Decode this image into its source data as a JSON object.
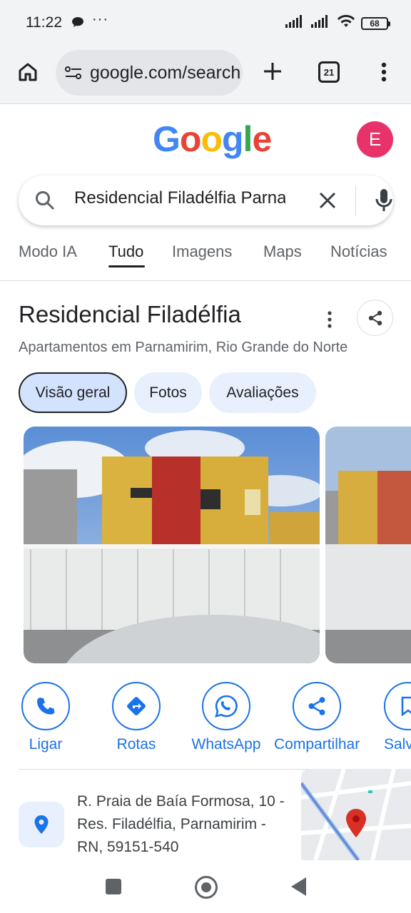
{
  "status_bar": {
    "time": "11:22",
    "dots": "···",
    "battery": "68"
  },
  "browser": {
    "url": "google.com/search",
    "tab_count": "21"
  },
  "google": {
    "logo_letters": [
      "G",
      "o",
      "o",
      "g",
      "l",
      "e"
    ],
    "logo_colors": [
      "#4285F4",
      "#EA4335",
      "#FBBC05",
      "#4285F4",
      "#34A853",
      "#EA4335"
    ],
    "avatar_initial": "E"
  },
  "search": {
    "query": "Residencial Filadélfia Parnamirim"
  },
  "tabs": [
    "Modo IA",
    "Tudo",
    "Imagens",
    "Maps",
    "Notícias"
  ],
  "active_tab": "Tudo",
  "place": {
    "title": "Residencial Filadélfia",
    "subtitle": "Apartamentos em Parnamirim, Rio Grande do Norte",
    "chips": [
      "Visão geral",
      "Fotos",
      "Avaliações"
    ],
    "selected_chip": "Visão geral"
  },
  "actions": [
    {
      "label": "Ligar",
      "icon": "phone-icon"
    },
    {
      "label": "Rotas",
      "icon": "directions-icon"
    },
    {
      "label": "WhatsApp",
      "icon": "whatsapp-icon"
    },
    {
      "label": "Compartilhar",
      "icon": "share-icon"
    },
    {
      "label": "Salvar",
      "icon": "bookmark-icon"
    }
  ],
  "address": {
    "text": "R. Praia de Baía Formosa, 10 - Res. Filadélfia, Parnamirim - RN, 59151-540"
  },
  "colors": {
    "accent": "#1a73e8",
    "avatar": "#e8336a",
    "chip_bg": "#e8f0fe",
    "map_pin": "#d93025"
  }
}
